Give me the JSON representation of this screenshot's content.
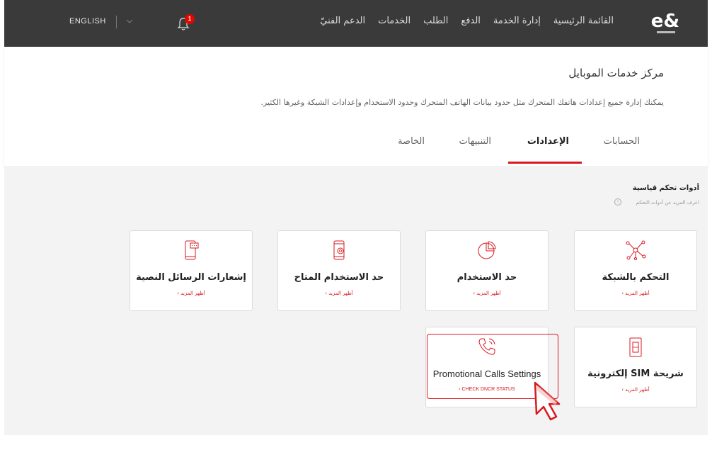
{
  "topbar": {
    "logo": "e&",
    "nav": [
      "القائمة الرئيسية",
      "إدارة الخدمة",
      "الدفع",
      "الطلب",
      "الخدمات",
      "الدعم الفنيّ"
    ],
    "notifications_count": "1",
    "language": "ENGLISH"
  },
  "header": {
    "title": "مركز خدمات الموبايل",
    "subtitle": "يمكنك إدارة جميع إعدادات هاتفك المتحرك مثل حدود بيانات الهاتف المتحرك وحدود الاستخدام وإعدادات الشبكة وغيرها الكثير.",
    "tabs": [
      {
        "label": "الحسابات",
        "active": false
      },
      {
        "label": "الإعدادات",
        "active": true
      },
      {
        "label": "التنبيهات",
        "active": false
      },
      {
        "label": "الخاصة",
        "active": false
      }
    ]
  },
  "section": {
    "title": "أدوات تحكم قياسية",
    "link": "اعرف المزيد عن أدوات التحكم"
  },
  "cards": [
    {
      "title": "التحكم بالشبكة",
      "more": "أظهر المزيد ›",
      "icon": "network-icon"
    },
    {
      "title": "حد الاستخدام",
      "more": "أظهر المزيد ›",
      "icon": "pie-chart-icon"
    },
    {
      "title": "حد الاستخدام المتاح",
      "more": "أظهر المزيد ›",
      "icon": "phone-at-icon"
    },
    {
      "title": "إشعارات الرسائل النصية",
      "more": "أظهر المزيد ›",
      "icon": "phone-sms-icon"
    },
    {
      "title": "شريحة SIM إلكترونية",
      "more": "أظهر المزيد ›",
      "icon": "sim-card-icon"
    },
    {
      "title": "Promotional Calls Settings",
      "more": "‹ CHECK DNCR STATUS",
      "icon": "phone-call-icon"
    }
  ],
  "colors": {
    "accent": "#d71920",
    "topbar": "#3a3a3a",
    "background": "#f3f3f3"
  }
}
